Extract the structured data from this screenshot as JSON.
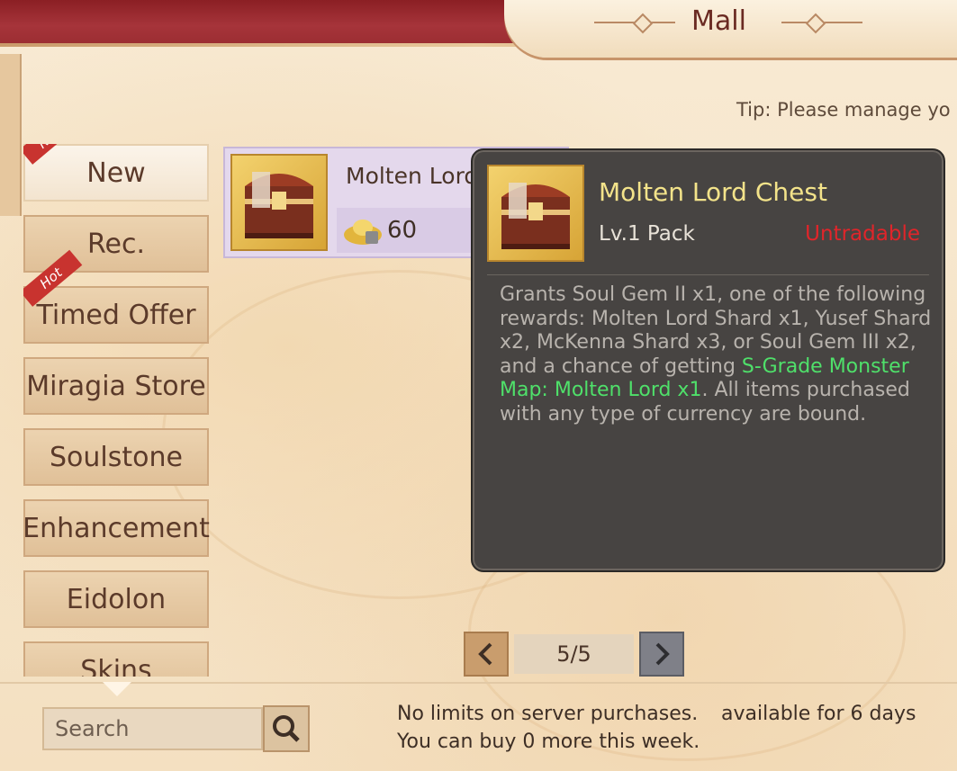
{
  "header": {
    "title": "Mall"
  },
  "tip": "Tip: Please manage yo",
  "sidebar": {
    "tabs": [
      {
        "label": "New",
        "badge": "New",
        "active": true
      },
      {
        "label": "Rec."
      },
      {
        "label": "Timed Offer",
        "badge": "Hot"
      },
      {
        "label": "Miragia Store"
      },
      {
        "label": "Soulstone"
      },
      {
        "label": "Enhancement"
      },
      {
        "label": "Eidolon"
      },
      {
        "label": "Skins"
      }
    ]
  },
  "item": {
    "name": "Molten Lord Chest",
    "price": "60",
    "currency_icon": "gold-ingot-icon"
  },
  "tooltip": {
    "title": "Molten Lord Chest",
    "level": "Lv.1 Pack",
    "tradable": "Untradable",
    "desc_pre": "Grants Soul Gem II x1, one of the following rewards: Molten Lord Shard x1, Yusef Shard x2, McKenna Shard x3, or Soul Gem III x2, and a chance of getting ",
    "desc_highlight": "S-Grade Monster Map: Molten Lord x1",
    "desc_post": ". All items purchased with any type of currency are bound."
  },
  "pager": {
    "page": "5/5"
  },
  "search": {
    "placeholder": "Search"
  },
  "footer": {
    "limit": "No limits on server purchases.",
    "weekly": "You can buy 0 more this week.",
    "availability": "available for 6 days"
  },
  "colors": {
    "accent_red": "#a6343a",
    "title_yellow": "#f3e38a",
    "untradable_red": "#e0252a",
    "highlight_green": "#4fe06a"
  }
}
